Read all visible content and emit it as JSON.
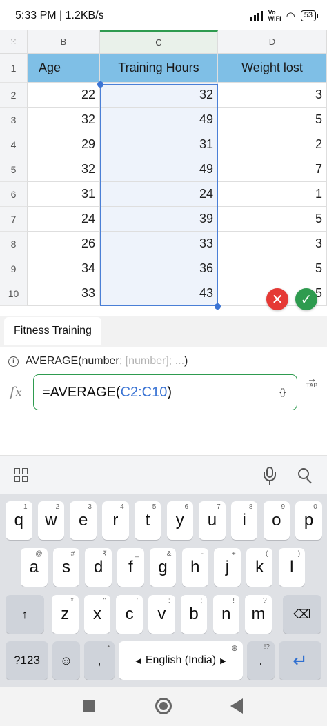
{
  "status_bar": {
    "time_speed": "5:33 PM | 1.2KB/s",
    "network_label": "Vo WiFi",
    "battery": "53"
  },
  "sheet": {
    "column_headers": [
      "B",
      "C",
      "D"
    ],
    "row_headers": [
      "1",
      "2",
      "3",
      "4",
      "5",
      "6",
      "7",
      "8",
      "9",
      "10"
    ],
    "header_row": [
      "Age",
      "Training Hours",
      "Weight lost"
    ],
    "rows": [
      [
        "22",
        "32",
        "3"
      ],
      [
        "32",
        "49",
        "5"
      ],
      [
        "29",
        "31",
        "2"
      ],
      [
        "32",
        "49",
        "7"
      ],
      [
        "31",
        "24",
        "1"
      ],
      [
        "24",
        "39",
        "5"
      ],
      [
        "26",
        "33",
        "3"
      ],
      [
        "34",
        "36",
        "5"
      ],
      [
        "33",
        "43",
        "5"
      ]
    ],
    "selected_range": "C2:C10",
    "accent": "#7fbfe6",
    "confirm_color": "#2e9b4f",
    "cancel_color": "#e53935"
  },
  "sheet_tab": {
    "name": "Fitness Training"
  },
  "formula_hint": {
    "function": "AVERAGE(number",
    "optional": "; [number]; ...",
    "close": ")"
  },
  "formula_bar": {
    "fx_label": "fx",
    "prefix": "=AVERAGE(",
    "reference": "C2:C10",
    "suffix": ")",
    "braces_label": "{}",
    "tab_label": "TAB"
  },
  "keyboard": {
    "row1": [
      {
        "k": "q",
        "s": "1"
      },
      {
        "k": "w",
        "s": "2"
      },
      {
        "k": "e",
        "s": "3"
      },
      {
        "k": "r",
        "s": "4"
      },
      {
        "k": "t",
        "s": "5"
      },
      {
        "k": "y",
        "s": "6"
      },
      {
        "k": "u",
        "s": "7"
      },
      {
        "k": "i",
        "s": "8"
      },
      {
        "k": "o",
        "s": "9"
      },
      {
        "k": "p",
        "s": "0"
      }
    ],
    "row2": [
      {
        "k": "a",
        "s": "@"
      },
      {
        "k": "s",
        "s": "#"
      },
      {
        "k": "d",
        "s": "₹"
      },
      {
        "k": "f",
        "s": "_"
      },
      {
        "k": "g",
        "s": "&"
      },
      {
        "k": "h",
        "s": "-"
      },
      {
        "k": "j",
        "s": "+"
      },
      {
        "k": "k",
        "s": "("
      },
      {
        "k": "l",
        "s": ")"
      }
    ],
    "row3": [
      {
        "k": "z",
        "s": "*"
      },
      {
        "k": "x",
        "s": "\""
      },
      {
        "k": "c",
        "s": "'"
      },
      {
        "k": "v",
        "s": ":"
      },
      {
        "k": "b",
        "s": ";"
      },
      {
        "k": "n",
        "s": "!"
      },
      {
        "k": "m",
        "s": "?"
      }
    ],
    "symbols_key": "?123",
    "comma_key": ",",
    "period_key": ".",
    "period_sup": "!?",
    "space_label": "English (India)",
    "shift_icon": "shift-arrow-icon",
    "backspace_icon": "backspace-icon",
    "enter_icon": "enter-arrow-icon"
  }
}
